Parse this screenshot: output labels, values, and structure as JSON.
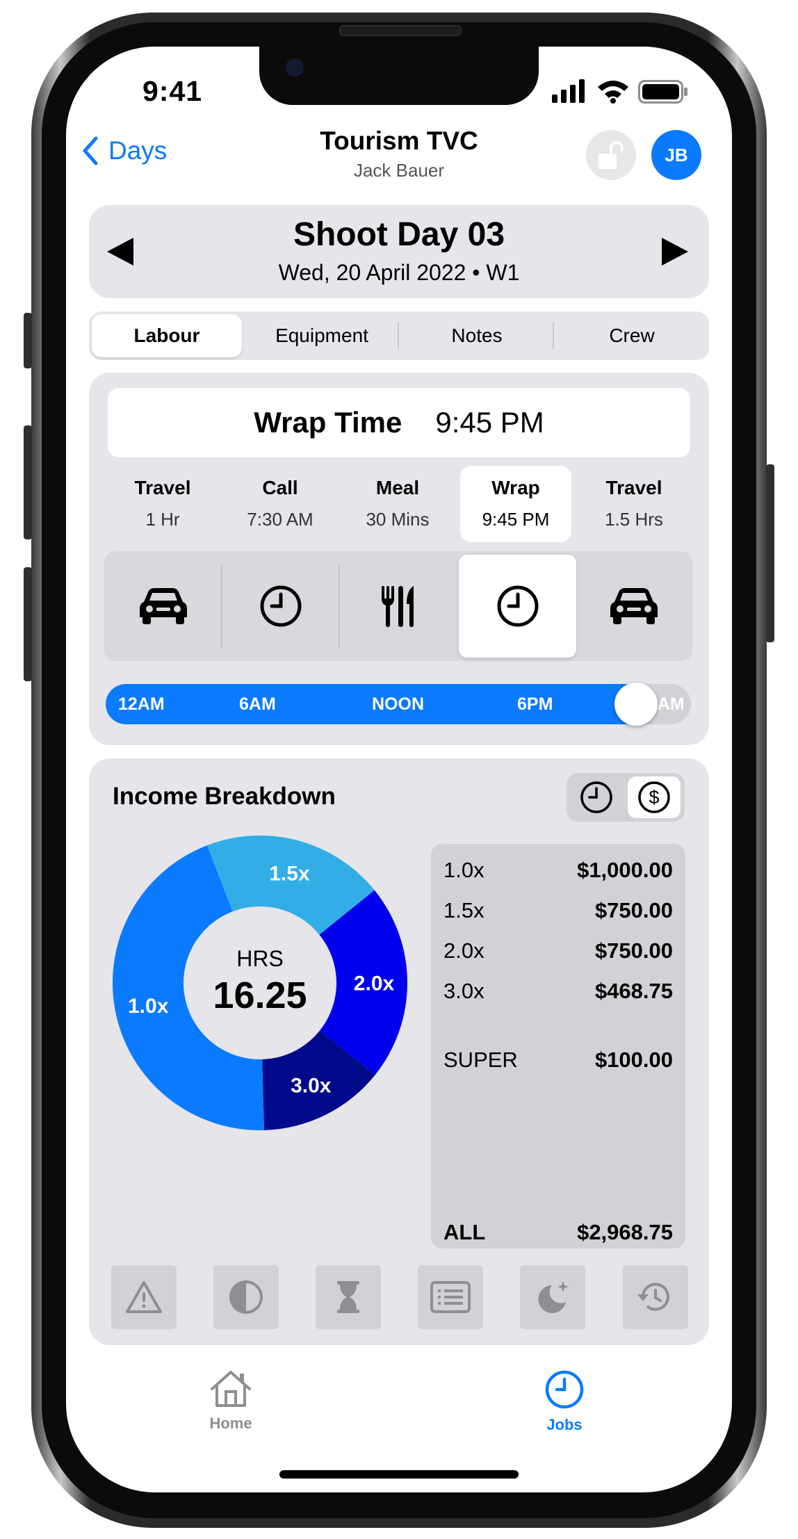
{
  "status_bar": {
    "time": "9:41"
  },
  "nav": {
    "back_label": "Days",
    "title": "Tourism TVC",
    "subtitle": "Jack Bauer",
    "avatar_initials": "JB"
  },
  "day": {
    "title": "Shoot Day 03",
    "subtitle": "Wed, 20 April 2022 • W1"
  },
  "tabs": [
    {
      "label": "Labour",
      "active": true
    },
    {
      "label": "Equipment",
      "active": false
    },
    {
      "label": "Notes",
      "active": false
    },
    {
      "label": "Crew",
      "active": false
    }
  ],
  "wrap": {
    "label": "Wrap Time",
    "value": "9:45 PM"
  },
  "phases": [
    {
      "name": "Travel",
      "value": "1 Hr",
      "icon": "car-icon",
      "active": false
    },
    {
      "name": "Call",
      "value": "7:30 AM",
      "icon": "clock-icon",
      "active": false
    },
    {
      "name": "Meal",
      "value": "30 Mins",
      "icon": "fork-knife-icon",
      "active": false
    },
    {
      "name": "Wrap",
      "value": "9:45 PM",
      "icon": "clock-icon",
      "active": true
    },
    {
      "name": "Travel",
      "value": "1.5 Hrs",
      "icon": "car-icon",
      "active": false
    }
  ],
  "timeline": {
    "ticks": [
      "12AM",
      "6AM",
      "NOON",
      "6PM",
      "12AM"
    ],
    "value_fraction": 0.906
  },
  "income": {
    "title": "Income Breakdown",
    "toggle": [
      "clock-icon",
      "dollar-icon"
    ],
    "toggle_active": 1,
    "center_label": "HRS",
    "center_value": "16.25",
    "rows": [
      {
        "rate": "1.0x",
        "amount": "$1,000.00"
      },
      {
        "rate": "1.5x",
        "amount": "$750.00"
      },
      {
        "rate": "2.0x",
        "amount": "$750.00"
      },
      {
        "rate": "3.0x",
        "amount": "$468.75"
      }
    ],
    "super": {
      "label": "SUPER",
      "amount": "$100.00"
    },
    "total": {
      "label": "ALL",
      "amount": "$2,968.75"
    },
    "colors": {
      "1.0x": "#0a7aff",
      "1.5x": "#32ade6",
      "2.0x": "#0000ee",
      "3.0x": "#000a8a"
    }
  },
  "chart_data": {
    "type": "pie",
    "categories": [
      "1.5x",
      "2.0x",
      "3.0x",
      "1.0x"
    ],
    "values": [
      3.25,
      3.5,
      2.25,
      7.25
    ],
    "center_label": "HRS",
    "center_value": 16.25
  },
  "tools": [
    "warning-icon",
    "contrast-icon",
    "hourglass-icon",
    "list-icon",
    "night-icon",
    "history-icon"
  ],
  "tabbar": [
    {
      "label": "Home",
      "icon": "home-icon",
      "active": false
    },
    {
      "label": "Jobs",
      "icon": "clock-icon",
      "active": true
    }
  ]
}
